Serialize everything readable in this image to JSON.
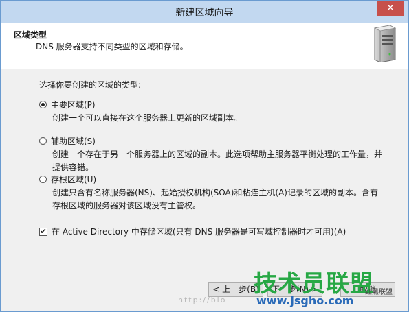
{
  "window": {
    "title": "新建区域向导",
    "close_glyph": "✕"
  },
  "header": {
    "title": "区域类型",
    "subtitle": "DNS 服务器支持不同类型的区域和存储。",
    "icon": "server-icon"
  },
  "prompt": "选择你要创建的区域的类型:",
  "options": [
    {
      "label": "主要区域(P)",
      "checked": true,
      "description": "创建一个可以直接在这个服务器上更新的区域副本。"
    },
    {
      "label": "辅助区域(S)",
      "checked": false,
      "description": "创建一个存在于另一个服务器上的区域的副本。此选项帮助主服务器平衡处理的工作量，并提供容错。"
    },
    {
      "label": "存根区域(U)",
      "checked": false,
      "description": "创建只含有名称服务器(NS)、起始授权机构(SOA)和粘连主机(A)记录的区域的副本。含有存根区域的服务器对该区域没有主管权。"
    }
  ],
  "ad_checkbox": {
    "label": "在 Active Directory 中存储区域(只有 DNS 服务器是可写域控制器时才可用)(A)",
    "checked": true,
    "mark": "✔"
  },
  "buttons": {
    "back": "< 上一步(B)",
    "next": "下一步(N) >",
    "cancel": "取消"
  },
  "watermark": {
    "text": "技术员联盟",
    "url": "www.jsgho.com",
    "side": "红黑联盟",
    "faint_url": "http://blo"
  }
}
